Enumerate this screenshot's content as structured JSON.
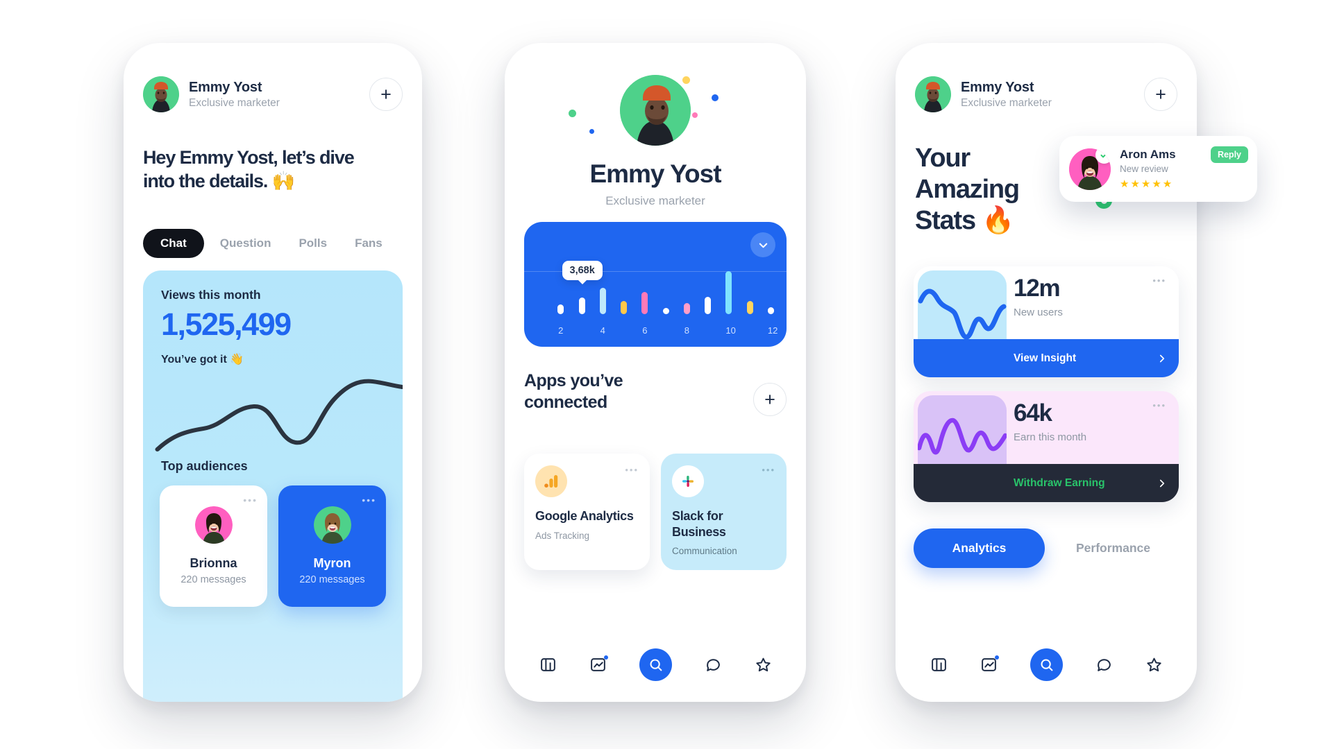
{
  "brand": {
    "blue": "#1f66f0",
    "dark": "#1d2b44",
    "green": "#4ed18a",
    "pink": "#ff5fc0",
    "purple": "#8b3df5"
  },
  "phone1": {
    "user": {
      "name": "Emmy  Yost",
      "role": "Exclusive marketer"
    },
    "add_label": "+",
    "headline": "Hey Emmy Yost, let’s dive into the details. 🙌",
    "tabs": [
      {
        "label": "Chat",
        "active": true
      },
      {
        "label": "Question",
        "active": false
      },
      {
        "label": "Polls",
        "active": false
      },
      {
        "label": "Fans",
        "active": false
      }
    ],
    "views": {
      "label": "Views this month",
      "value": "1,525,499",
      "praise": "You’ve got it 👋",
      "top_audiences_label": "Top audiences"
    },
    "audiences": [
      {
        "name": "Brionna",
        "messages": "220 messages",
        "theme": "white",
        "ring": "#ff5fc0",
        "dots": "•••"
      },
      {
        "name": "Myron",
        "messages": "220 messages",
        "theme": "blue",
        "ring": "#4ed18a",
        "dots": "•••"
      }
    ]
  },
  "phone2": {
    "user": {
      "name": "Emmy Yost",
      "role": "Exclusive marketer"
    },
    "chart_data": {
      "type": "bar",
      "title": "",
      "tooltip_value": "3,68k",
      "tooltip_index": 2,
      "categories": [
        "1",
        "2",
        "3",
        "4",
        "5",
        "6",
        "7",
        "8",
        "9",
        "10",
        "11",
        "12"
      ],
      "tick_labels": [
        "",
        "2",
        "",
        "4",
        "",
        "6",
        "",
        "8",
        "",
        "10",
        "",
        "12"
      ],
      "values": [
        0,
        22,
        38,
        62,
        30,
        52,
        14,
        26,
        40,
        100,
        30,
        16
      ],
      "colors": [
        "#1f66f0",
        "#ffffff",
        "#ffffff",
        "#bfe9fb",
        "#ffc84a",
        "#ff7ab8",
        "#ffffff",
        "#ff9ec9",
        "#ffffff",
        "#7fe3ff",
        "#ffd45e",
        "#ffffff"
      ],
      "xlabel": "",
      "ylabel": "",
      "grid": true,
      "legend": "none"
    },
    "apps": {
      "title": "Apps you’ve connected",
      "add_label": "+",
      "items": [
        {
          "name": "Google Analytics",
          "desc": "Ads Tracking",
          "theme": "white",
          "icon": "google-analytics-icon",
          "dots": "•••"
        },
        {
          "name": "Slack for Business",
          "desc": "Communication",
          "theme": "cyan",
          "icon": "slack-icon",
          "dots": "•••"
        }
      ]
    },
    "nav": [
      {
        "name": "dashboard-icon",
        "active": false,
        "badge": false
      },
      {
        "name": "analytics-icon",
        "active": false,
        "badge": true
      },
      {
        "name": "search-icon",
        "active": true,
        "badge": false
      },
      {
        "name": "chat-icon",
        "active": false,
        "badge": false
      },
      {
        "name": "star-icon",
        "active": false,
        "badge": false
      }
    ]
  },
  "phone3": {
    "user": {
      "name": "Emmy  Yost",
      "role": "Exclusive marketer"
    },
    "add_label": "+",
    "headline": "Your Amazing Stats 🔥",
    "stats": [
      {
        "value": "12m",
        "label": "New users",
        "action": "View Insight",
        "dots": "•••",
        "chevron": "›"
      },
      {
        "value": "64k",
        "label": "Earn this month",
        "action": "Withdraw Earning",
        "dots": "•••",
        "chevron": "›"
      }
    ],
    "segments": [
      {
        "label": "Analytics",
        "active": true
      },
      {
        "label": "Performance",
        "active": false
      }
    ],
    "nav": [
      {
        "name": "dashboard-icon",
        "active": false,
        "badge": false
      },
      {
        "name": "analytics-icon",
        "active": false,
        "badge": true
      },
      {
        "name": "search-icon",
        "active": true,
        "badge": false
      },
      {
        "name": "chat-icon",
        "active": false,
        "badge": false
      },
      {
        "name": "star-icon",
        "active": false,
        "badge": false
      }
    ],
    "toast": {
      "name": "Aron Ams",
      "subtitle": "New review",
      "reply_label": "Reply",
      "stars": "★★★★★",
      "verified": true
    }
  }
}
